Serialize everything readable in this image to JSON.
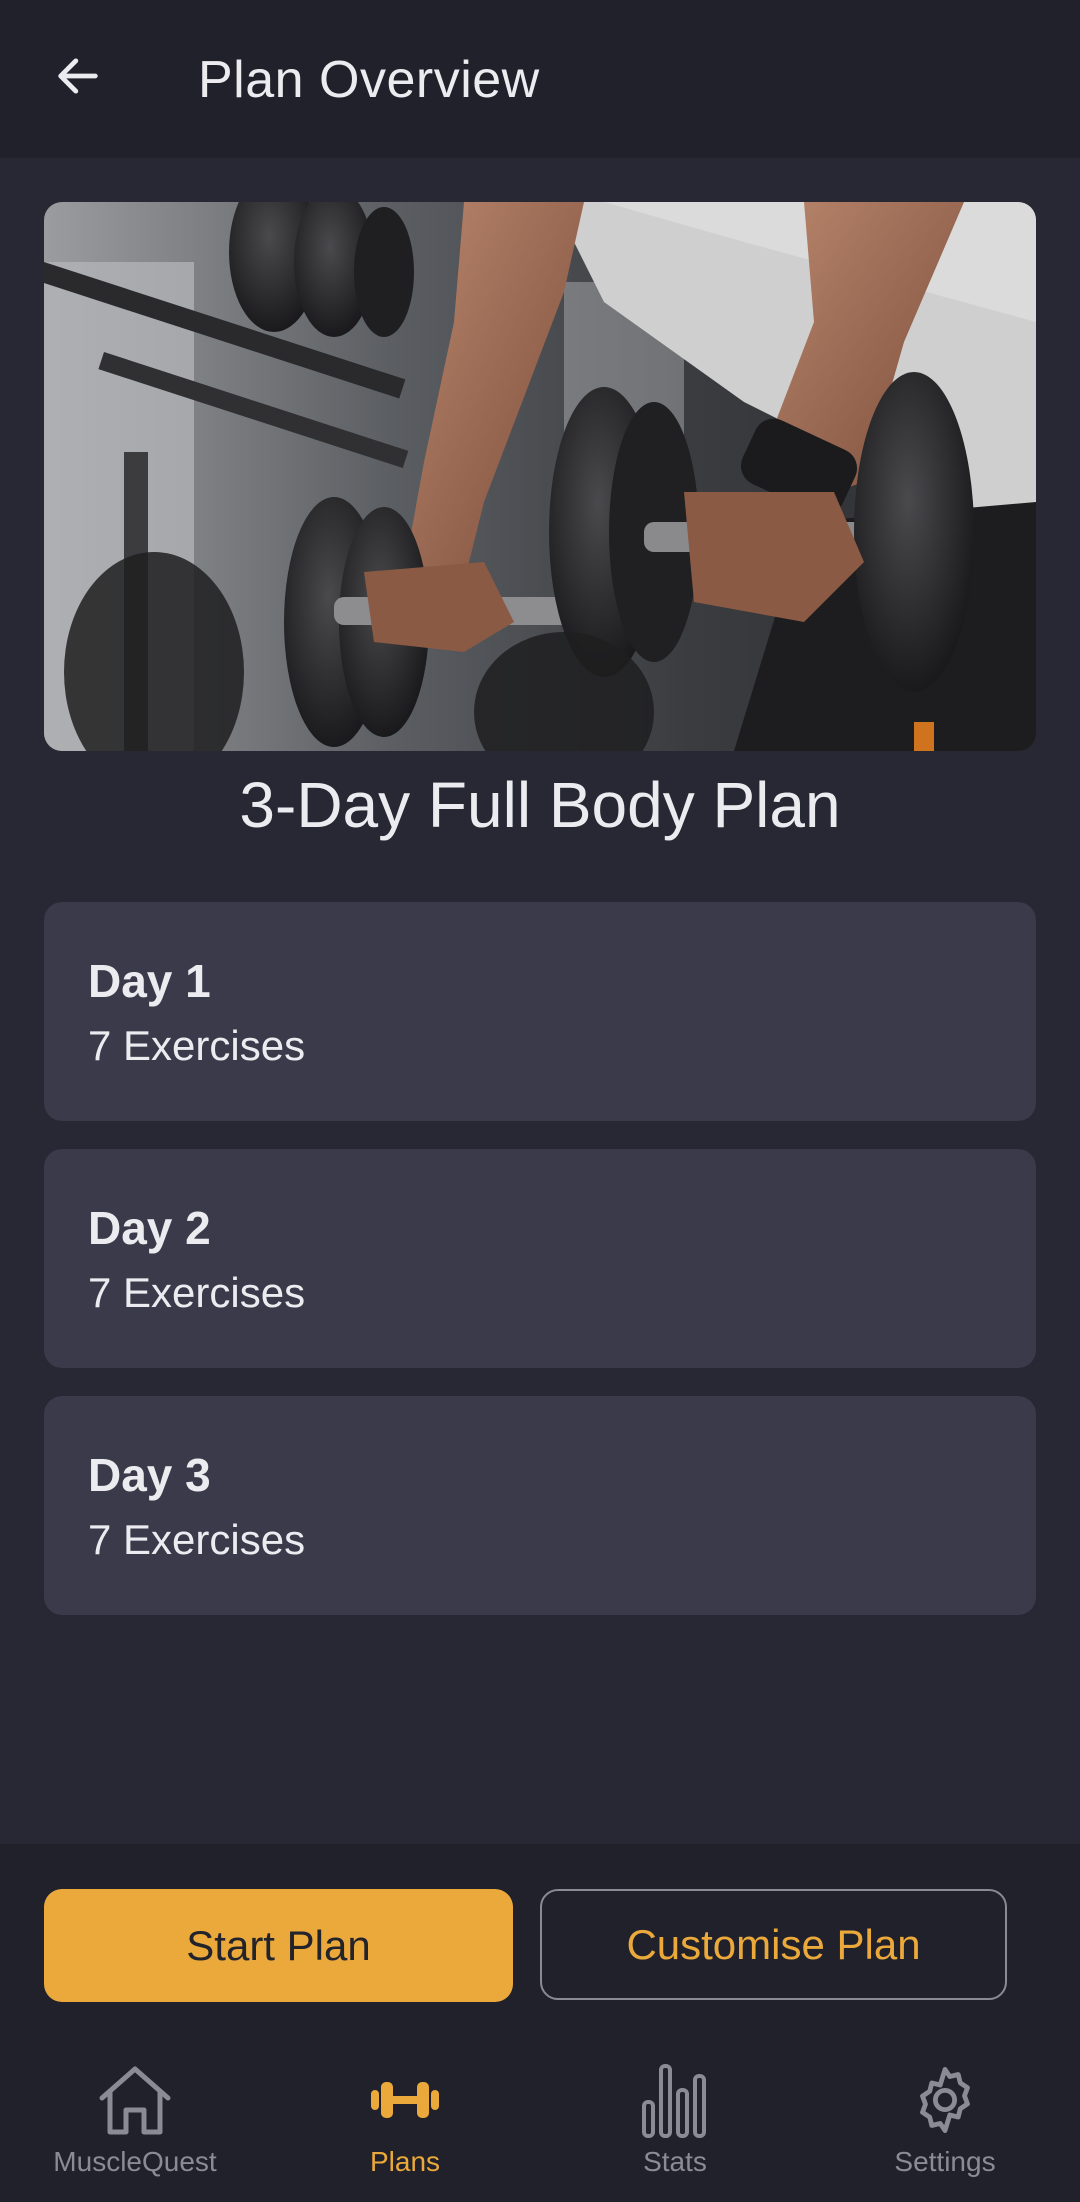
{
  "header": {
    "title": "Plan Overview",
    "back_icon": "arrow-left-icon"
  },
  "hero": {
    "image": "dumbbell-rack-photo"
  },
  "plan": {
    "title": "3-Day Full Body Plan",
    "days": [
      {
        "name": "Day 1",
        "exercises": "7 Exercises"
      },
      {
        "name": "Day 2",
        "exercises": "7 Exercises"
      },
      {
        "name": "Day 3",
        "exercises": "7 Exercises"
      }
    ]
  },
  "actions": {
    "start_label": "Start Plan",
    "customise_label": "Customise Plan"
  },
  "nav": {
    "items": [
      {
        "label": "MuscleQuest",
        "icon": "home-icon",
        "active": false
      },
      {
        "label": "Plans",
        "icon": "dumbbell-icon",
        "active": true
      },
      {
        "label": "Stats",
        "icon": "bar-chart-icon",
        "active": false
      },
      {
        "label": "Settings",
        "icon": "gear-icon",
        "active": false
      }
    ]
  },
  "colors": {
    "background": "#282834",
    "surface": "#21212b",
    "card": "#3b3a4b",
    "accent": "#eaa93a",
    "muted": "#8b8b96"
  }
}
